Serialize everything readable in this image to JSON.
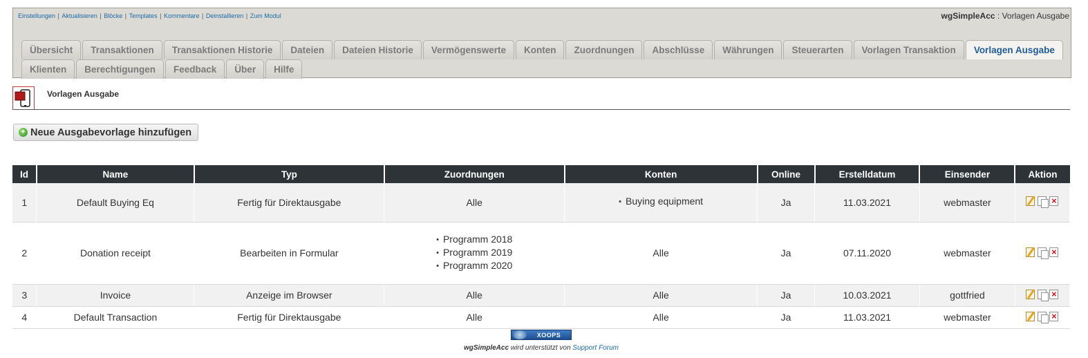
{
  "toplinks": [
    "Einstellungen",
    "Aktualisieren",
    "Blöcke",
    "Templates",
    "Kommentare",
    "Deinstallieren",
    "Zum Modul"
  ],
  "module": {
    "name": "wgSimpleAcc",
    "section": "Vorlagen Ausgabe"
  },
  "tabs_row1": [
    "Übersicht",
    "Transaktionen",
    "Transaktionen Historie",
    "Dateien",
    "Dateien Historie",
    "Vermögenswerte",
    "Konten",
    "Zuordnungen",
    "Abschlüsse",
    "Währungen",
    "Steuerarten",
    "Vorlagen Transaktion",
    "Vorlagen Ausgabe"
  ],
  "tabs_row2": [
    "Klienten",
    "Berechtigungen",
    "Feedback",
    "Über",
    "Hilfe"
  ],
  "active_tab": "Vorlagen Ausgabe",
  "page_heading": "Vorlagen Ausgabe",
  "add_button": "Neue Ausgabevorlage hinzufügen",
  "table": {
    "headers": [
      "Id",
      "Name",
      "Typ",
      "Zuordnungen",
      "Konten",
      "Online",
      "Erstelldatum",
      "Einsender",
      "Aktion"
    ],
    "rows": [
      {
        "id": "1",
        "name": "Default Buying Eq",
        "typ": "Fertig für Direktausgabe",
        "zuordnungen": "Alle",
        "konten": "Buying equipment",
        "online": "Ja",
        "datum": "11.03.2021",
        "einsender": "webmaster"
      },
      {
        "id": "2",
        "name": "Donation receipt",
        "typ": "Bearbeiten in Formular",
        "zuordnungen_list": [
          "Programm 2018",
          "Programm 2019",
          "Programm 2020"
        ],
        "konten": "Alle",
        "online": "Ja",
        "datum": "07.11.2020",
        "einsender": "webmaster"
      },
      {
        "id": "3",
        "name": "Invoice",
        "typ": "Anzeige im Browser",
        "zuordnungen": "Alle",
        "konten": "Alle",
        "online": "Ja",
        "datum": "10.03.2021",
        "einsender": "gottfried"
      },
      {
        "id": "4",
        "name": "Default Transaction",
        "typ": "Fertig für Direktausgabe",
        "zuordnungen": "Alle",
        "konten": "Alle",
        "online": "Ja",
        "datum": "11.03.2021",
        "einsender": "webmaster"
      }
    ]
  },
  "footer": {
    "badge": "XOOPS",
    "module": "wgSimpleAcc",
    "text": "wird unterstützt von",
    "link": "Support Forum"
  }
}
